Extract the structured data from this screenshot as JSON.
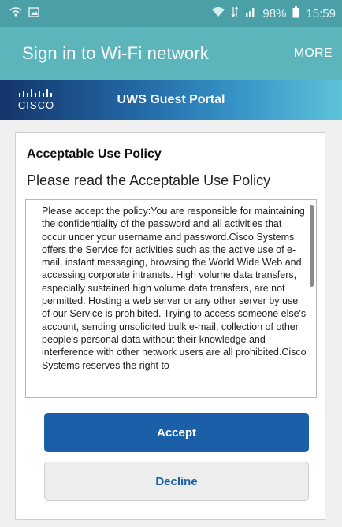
{
  "status_bar": {
    "battery": "98%",
    "time": "15:59",
    "icons_left": [
      "wifi-sign-in-icon",
      "image-icon"
    ],
    "icons_right": [
      "wifi-icon",
      "mobile-data-icon",
      "signal-icon",
      "battery-icon"
    ]
  },
  "app_bar": {
    "title": "Sign in to Wi-Fi network",
    "more_label": "MORE"
  },
  "portal": {
    "logo_text": "CISCO",
    "title": "UWS Guest Portal"
  },
  "policy": {
    "heading": "Acceptable Use Policy",
    "subheading": "Please read the Acceptable Use Policy",
    "text": "Please accept the policy:You are responsible for maintaining the confidentiality of the password and all activities that occur under your username and password.Cisco Systems offers the Service for activities such as the active use of e-mail, instant messaging, browsing the World Wide Web and accessing corporate intranets. High volume data transfers, especially sustained high volume data transfers, are not permitted. Hosting a web server or any other server by use of our Service is prohibited. Trying to access someone else's account, sending unsolicited bulk e-mail, collection of other people's personal data without their knowledge and interference with other network users are all prohibited.Cisco Systems reserves the right to"
  },
  "buttons": {
    "accept": "Accept",
    "decline": "Decline"
  },
  "colors": {
    "status_bar": "#4aa0a6",
    "app_bar": "#5bb5bb",
    "accept_bg": "#1a5fa8",
    "decline_text": "#1a5fa8"
  }
}
